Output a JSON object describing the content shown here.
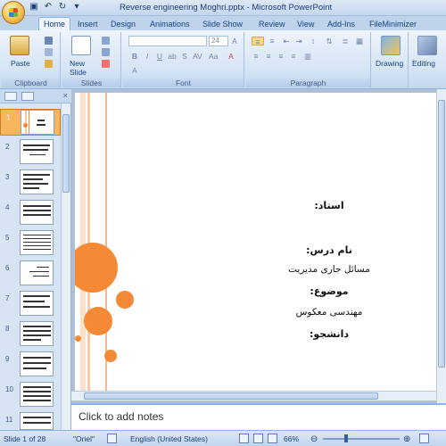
{
  "window": {
    "title": "Reverse engineering Moghri.pptx - Microsoft PowerPoint"
  },
  "quick_access": [
    "save-icon",
    "undo-icon",
    "redo-icon",
    "customize-icon"
  ],
  "tabs": [
    {
      "label": "Home",
      "active": true
    },
    {
      "label": "Insert"
    },
    {
      "label": "Design"
    },
    {
      "label": "Animations"
    },
    {
      "label": "Slide Show"
    },
    {
      "label": "Review"
    },
    {
      "label": "View"
    },
    {
      "label": "Add-Ins"
    },
    {
      "label": "FileMinimizer"
    }
  ],
  "ribbon": {
    "clipboard": {
      "paste": "Paste",
      "group": "Clipboard"
    },
    "slides": {
      "new_slide": "New Slide",
      "group": "Slides"
    },
    "font": {
      "font_name": "",
      "font_size": "24",
      "group": "Font"
    },
    "paragraph": {
      "group": "Paragraph"
    },
    "drawing": {
      "label": "Drawing"
    },
    "editing": {
      "label": "Editing"
    }
  },
  "thumbnails": [
    "1",
    "2",
    "3",
    "4",
    "5",
    "6",
    "7",
    "8",
    "9",
    "10",
    "11"
  ],
  "slide": {
    "lines": [
      "استاد:",
      "نام درس:",
      "مسائل جاری مدیریت",
      "موضوع:",
      "مهندسی معکوس",
      "دانشجو:"
    ]
  },
  "notes": {
    "placeholder": "Click to add notes"
  },
  "status": {
    "slide_info": "Slide 1 of 28",
    "theme": "\"Oriel\"",
    "language": "English (United States)",
    "zoom": "66%"
  },
  "colors": {
    "accent_orange": "#f48a36",
    "ribbon_blue": "#bfd3ea"
  }
}
